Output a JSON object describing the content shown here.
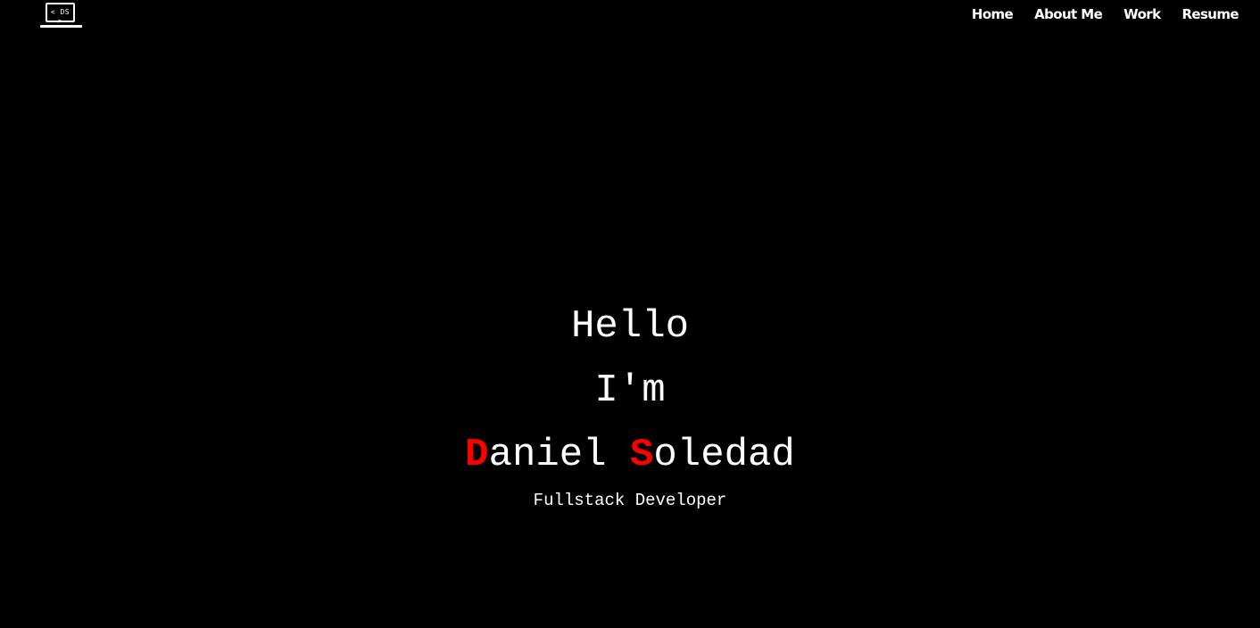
{
  "header": {
    "logo_text": "< DS >",
    "nav": [
      {
        "label": "Home"
      },
      {
        "label": "About Me"
      },
      {
        "label": "Work"
      },
      {
        "label": "Resume"
      }
    ]
  },
  "hero": {
    "line1": "Hello",
    "line2": "I'm",
    "first_initial": "D",
    "first_rest": "aniel",
    "last_initial": "S",
    "last_rest": "oledad",
    "subtitle": "Fullstack Developer"
  },
  "colors": {
    "background": "#000000",
    "text": "#ffffff",
    "accent": "#ff0000"
  }
}
